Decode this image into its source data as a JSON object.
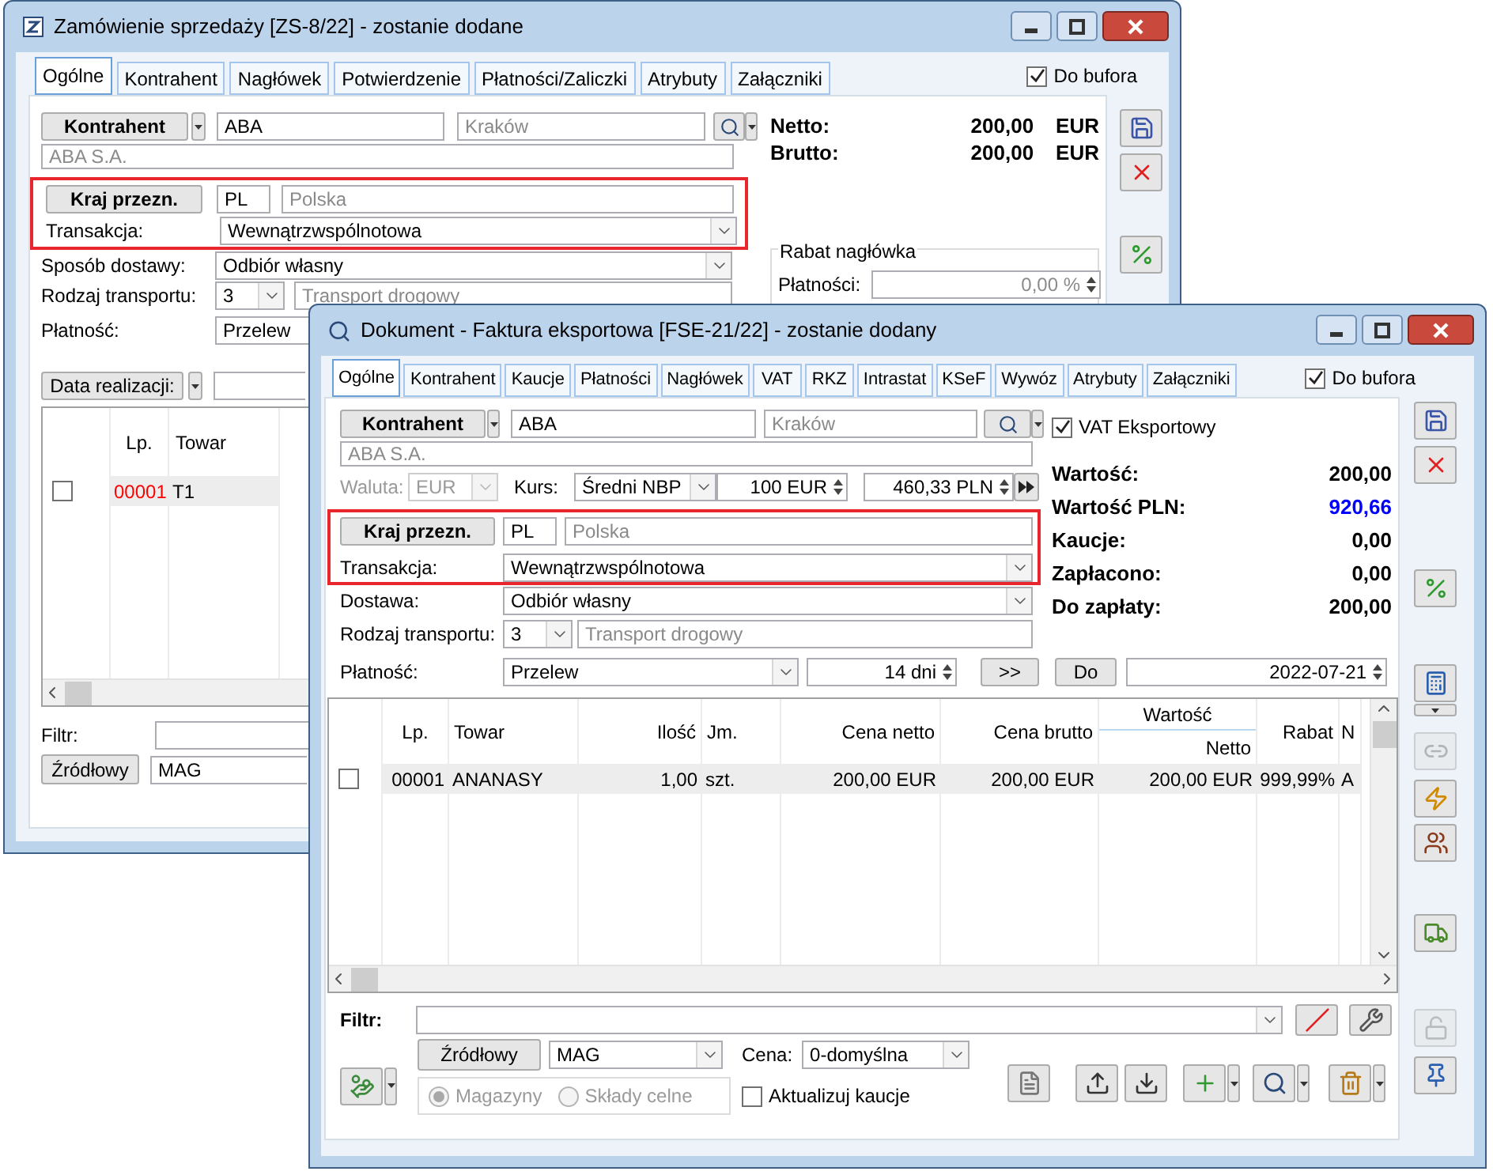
{
  "back_window": {
    "title": "Zamówienie sprzedaży [ZS-8/22] - zostanie dodane",
    "tabs": [
      {
        "label": "Ogólne",
        "selected": true
      },
      {
        "label": "Kontrahent",
        "selected": false
      },
      {
        "label": "Nagłówek",
        "selected": false
      },
      {
        "label": "Potwierdzenie",
        "selected": false
      },
      {
        "label": "Płatności/Zaliczki",
        "selected": false
      },
      {
        "label": "Atrybuty",
        "selected": false
      },
      {
        "label": "Załączniki",
        "selected": false
      }
    ],
    "buffer": {
      "label": "Do bufora",
      "checked": true
    },
    "contractor": {
      "button": "Kontrahent",
      "code": "ABA",
      "city": "Kraków",
      "name": "ABA S.A."
    },
    "destination": {
      "button": "Kraj przezn.",
      "code": "PL",
      "country": "Polska",
      "highlighted": true
    },
    "transaction": {
      "label": "Transakcja:",
      "value": "Wewnątrzwspólnotowa"
    },
    "delivery": {
      "label": "Sposób dostawy:",
      "value": "Odbiór własny"
    },
    "transport": {
      "label": "Rodzaj transportu:",
      "code": "3",
      "value": "Transport drogowy"
    },
    "payment": {
      "label": "Płatność:",
      "value": "Przelew"
    },
    "totals": [
      {
        "label": "Netto:",
        "value": "200,00",
        "currency": "EUR"
      },
      {
        "label": "Brutto:",
        "value": "200,00",
        "currency": "EUR"
      }
    ],
    "discount": {
      "title": "Rabat nagłówka",
      "label": "Płatności:",
      "value": "0,00 %"
    },
    "date_button": "Data realizacji:",
    "table": {
      "columns": [
        {
          "label": "Lp."
        },
        {
          "label": "Towar"
        }
      ],
      "rows": [
        {
          "checked": false,
          "color": "#ff0000",
          "cells": [
            "00001",
            "T1"
          ]
        }
      ]
    },
    "filter_label": "Filtr:",
    "source_button": "Źródłowy",
    "warehouse": "MAG"
  },
  "front_window": {
    "title": "Dokument - Faktura eksportowa [FSE-21/22] - zostanie dodany",
    "tabs": [
      {
        "label": "Ogólne",
        "selected": true
      },
      {
        "label": "Kontrahent",
        "selected": false
      },
      {
        "label": "Kaucje",
        "selected": false
      },
      {
        "label": "Płatności",
        "selected": false
      },
      {
        "label": "Nagłówek",
        "selected": false
      },
      {
        "label": "VAT",
        "selected": false
      },
      {
        "label": "RKZ",
        "selected": false
      },
      {
        "label": "Intrastat",
        "selected": false
      },
      {
        "label": "KSeF",
        "selected": false
      },
      {
        "label": "Wywóz",
        "selected": false
      },
      {
        "label": "Atrybuty",
        "selected": false
      },
      {
        "label": "Załączniki",
        "selected": false
      }
    ],
    "buffer": {
      "label": "Do bufora",
      "checked": true
    },
    "contractor": {
      "button": "Kontrahent",
      "code": "ABA",
      "city": "Kraków",
      "name": "ABA S.A."
    },
    "currency": {
      "label": "Waluta:",
      "value": "EUR",
      "disabled": true
    },
    "rate": {
      "label": "Kurs:",
      "type": "Średni NBP",
      "amount": "100 EUR",
      "pln": "460,33 PLN"
    },
    "destination": {
      "button": "Kraj przezn.",
      "code": "PL",
      "country": "Polska",
      "highlighted": true
    },
    "transaction": {
      "label": "Transakcja:",
      "value": "Wewnątrzwspólnotowa"
    },
    "delivery": {
      "label": "Dostawa:",
      "value": "Odbiór własny"
    },
    "transport": {
      "label": "Rodzaj transportu:",
      "code": "3",
      "value": "Transport drogowy"
    },
    "payment": {
      "label": "Płatność:",
      "method": "Przelew",
      "term": "14 dni",
      "arrow_button": ">>",
      "due_button": "Do",
      "due_date": "2022-07-21"
    },
    "export_vat": {
      "label": "VAT Eksportowy",
      "checked": true
    },
    "summary": [
      {
        "label": "Wartość:",
        "value": "200,00",
        "color": "#000000"
      },
      {
        "label": "Wartość PLN:",
        "value": "920,66",
        "color": "#0000ff"
      },
      {
        "label": "Kaucje:",
        "value": "0,00",
        "color": "#000000"
      },
      {
        "label": "Zapłacono:",
        "value": "0,00",
        "color": "#000000"
      },
      {
        "label": "Do zapłaty:",
        "value": "200,00",
        "color": "#000000"
      }
    ],
    "table": {
      "columns": [
        {
          "label": "Lp."
        },
        {
          "label": "Towar"
        },
        {
          "label": "Ilość"
        },
        {
          "label": "Jm."
        },
        {
          "label": "Cena netto"
        },
        {
          "label": "Cena brutto"
        },
        {
          "label": "Netto",
          "group": "Wartość"
        },
        {
          "label": "Rabat"
        },
        {
          "label": "N"
        }
      ],
      "rows": [
        {
          "checked": false,
          "color": "#000000",
          "cells": [
            "00001",
            "ANANASY",
            "1,00",
            "szt.",
            "200,00 EUR",
            "200,00 EUR",
            "200,00 EUR",
            "999,99%",
            "A"
          ]
        }
      ]
    },
    "filter_label": "Filtr:",
    "source_button": "Źródłowy",
    "warehouse": "MAG",
    "price_label": "Cena:",
    "price": "0-domyślna",
    "stock_types": {
      "disabled": true,
      "options": [
        {
          "label": "Magazyny",
          "selected": true
        },
        {
          "label": "Składy celne",
          "selected": false
        }
      ]
    },
    "update_deposits": {
      "label": "Aktualizuj kaucje",
      "checked": false
    }
  }
}
